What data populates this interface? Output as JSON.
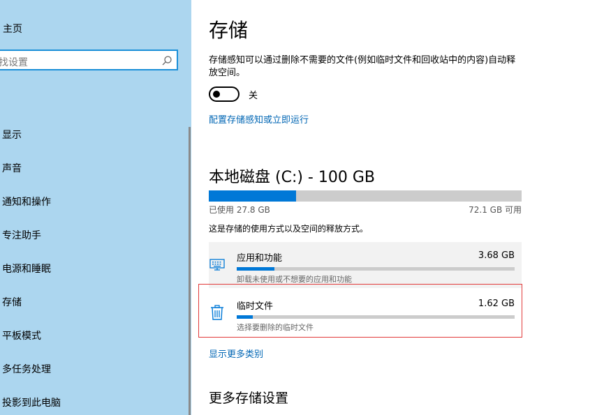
{
  "sidebar": {
    "home_label": "主页",
    "search_placeholder": "找设置",
    "items": [
      {
        "label": "显示"
      },
      {
        "label": "声音"
      },
      {
        "label": "通知和操作"
      },
      {
        "label": "专注助手"
      },
      {
        "label": "电源和睡眠"
      },
      {
        "label": "存储"
      },
      {
        "label": "平板模式"
      },
      {
        "label": "多任务处理"
      },
      {
        "label": "投影到此电脑"
      }
    ]
  },
  "main": {
    "title": "存储",
    "storage_sense_desc": "存储感知可以通过删除不需要的文件(例如临时文件和回收站中的内容)自动释放空间。",
    "toggle_state_label": "关",
    "toggle_on": false,
    "configure_link": "配置存储感知或立即运行",
    "disk": {
      "title": "本地磁盘 (C:) - 100 GB",
      "used_label": "已使用 27.8 GB",
      "free_label": "72.1 GB 可用",
      "used_fraction": 0.278
    },
    "usage_desc": "这是存储的使用方式以及空间的释放方式。",
    "categories": [
      {
        "name": "应用和功能",
        "size": "3.68 GB",
        "sub": "卸载未使用或不想要的应用和功能",
        "fraction": 0.135,
        "icon": "keyboard-icon"
      },
      {
        "name": "临时文件",
        "size": "1.62 GB",
        "sub": "选择要删除的临时文件",
        "fraction": 0.058,
        "icon": "trash-icon"
      }
    ],
    "more_categories_link": "显示更多类别",
    "more_settings_title": "更多存储设置"
  },
  "colors": {
    "accent": "#0078d7",
    "link": "#0066b4",
    "sidebar_bg": "#acd6ef",
    "highlight_border": "#e23a3a"
  }
}
